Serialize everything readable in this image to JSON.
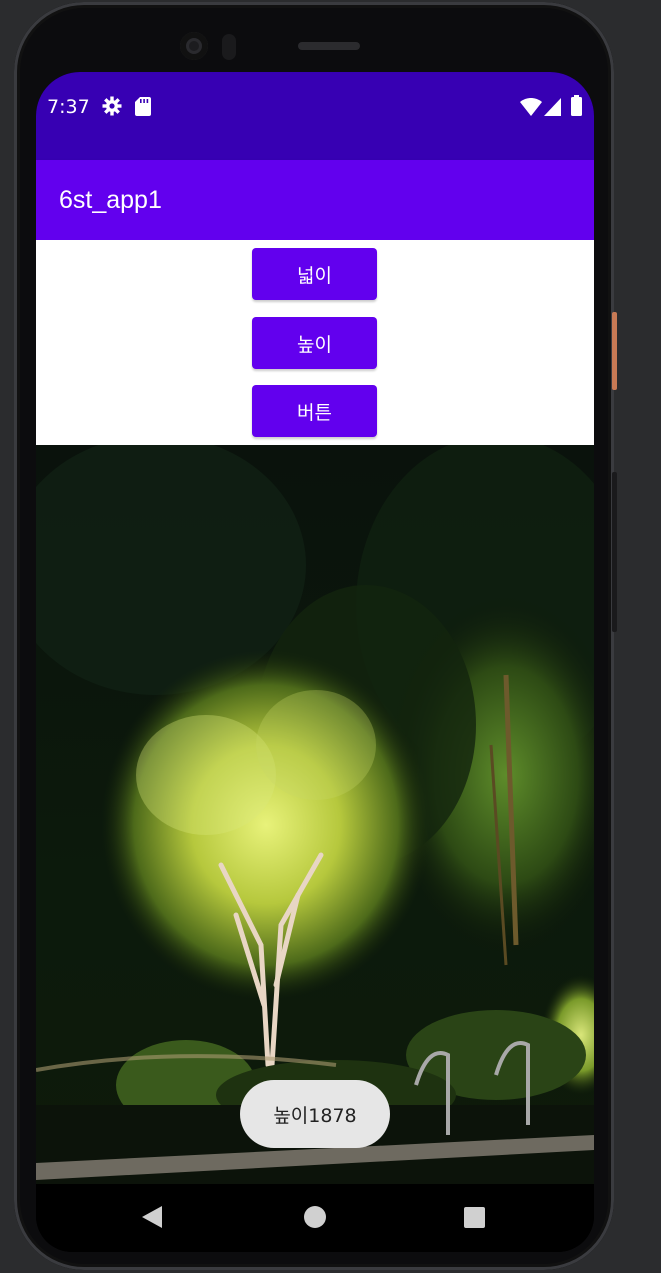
{
  "status_bar": {
    "time": "7:37",
    "icons": [
      "gear-icon",
      "sd-card-icon",
      "wifi-icon",
      "signal-icon",
      "battery-icon"
    ]
  },
  "app_bar": {
    "title": "6st_app1"
  },
  "buttons": {
    "width": "넓이",
    "height": "높이",
    "button": "버튼"
  },
  "image": {
    "description": "night-lit-tree-garden-photo"
  },
  "toast": {
    "text": "높이1878"
  },
  "nav_bar": {
    "icons": [
      "back-icon",
      "home-icon",
      "recents-icon"
    ]
  },
  "colors": {
    "status_bar": "#3700b3",
    "app_bar": "#6200ee",
    "button": "#6200ee",
    "toast": "#e6e6e6"
  }
}
